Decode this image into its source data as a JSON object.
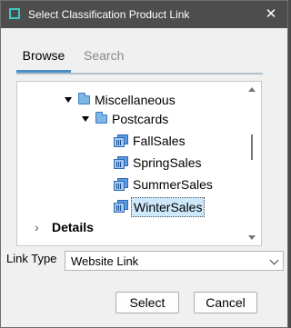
{
  "window": {
    "title": "Select Classification Product Link"
  },
  "tabs": [
    {
      "label": "Browse",
      "active": true
    },
    {
      "label": "Search",
      "active": false
    }
  ],
  "tree": {
    "folders": [
      {
        "label": "Miscellaneous",
        "expanded": true
      },
      {
        "label": "Postcards",
        "expanded": true
      }
    ],
    "items": [
      {
        "label": "FallSales",
        "selected": false
      },
      {
        "label": "SpringSales",
        "selected": false
      },
      {
        "label": "SummerSales",
        "selected": false
      },
      {
        "label": "WinterSales",
        "selected": true
      }
    ]
  },
  "details": {
    "label": "Details",
    "expanded": false
  },
  "link_type": {
    "label": "Link Type",
    "value": "Website Link"
  },
  "buttons": {
    "select": "Select",
    "cancel": "Cancel"
  },
  "colors": {
    "titlebar": "#4d4d4d",
    "accent": "#4a8ec7",
    "selection": "#cde8fb",
    "folder": "#7fb6e6"
  }
}
